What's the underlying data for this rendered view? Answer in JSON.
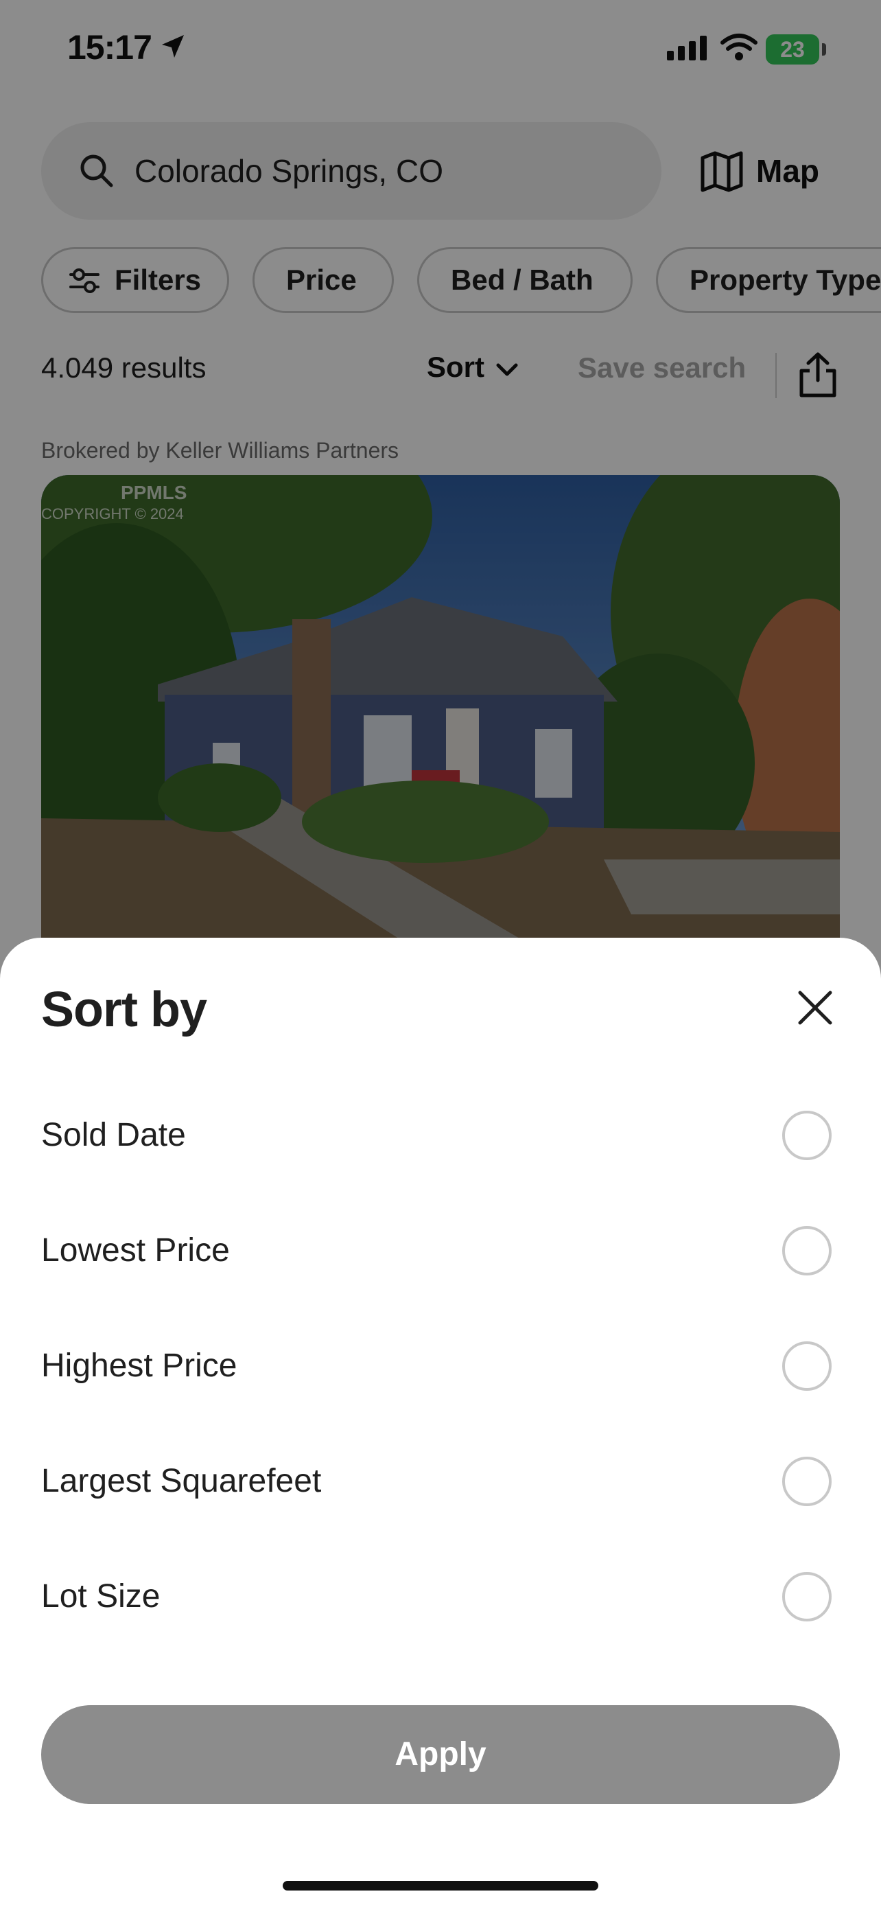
{
  "status_bar": {
    "time": "15:17",
    "battery": "23"
  },
  "search": {
    "location": "Colorado Springs, CO",
    "map_label": "Map"
  },
  "filters": {
    "chips": [
      "Filters",
      "Price",
      "Bed / Bath",
      "Property Type"
    ]
  },
  "results": {
    "count": "4.049 results",
    "sort_label": "Sort",
    "save_search_label": "Save search"
  },
  "listing": {
    "brokered_by": "Brokered by Keller Williams Partners",
    "watermark": "PPMLS",
    "watermark_sub": "COPYRIGHT © 2024"
  },
  "sort_sheet": {
    "title": "Sort by",
    "options": [
      {
        "label": "Sold Date",
        "selected": false
      },
      {
        "label": "Lowest Price",
        "selected": false
      },
      {
        "label": "Highest Price",
        "selected": false
      },
      {
        "label": "Largest Squarefeet",
        "selected": false
      },
      {
        "label": "Lot Size",
        "selected": false
      }
    ],
    "apply_label": "Apply"
  },
  "colors": {
    "scrim": "#000000",
    "apply_disabled": "#8c8c8c",
    "battery": "#34c759"
  }
}
